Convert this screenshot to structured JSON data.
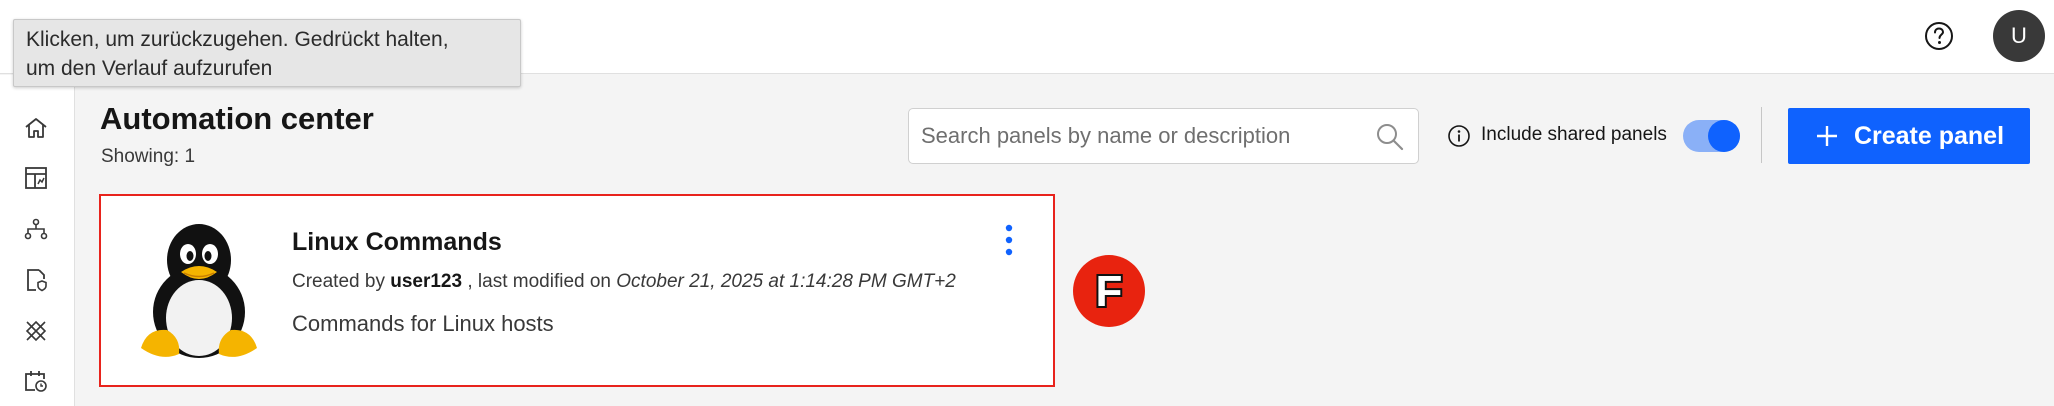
{
  "tooltip": {
    "line1": "Klicken, um zurückzugehen. Gedrückt halten,",
    "line2": "um den Verlauf aufzurufen"
  },
  "header": {
    "help_icon": "question-circle-icon",
    "avatar_initial": "U"
  },
  "sidebar": {
    "items": [
      {
        "icon": "home-icon"
      },
      {
        "icon": "dashboard-icon"
      },
      {
        "icon": "workflow-icon"
      },
      {
        "icon": "document-shield-icon"
      },
      {
        "icon": "automation-icon"
      },
      {
        "icon": "calendar-clock-icon"
      }
    ]
  },
  "main": {
    "title": "Automation center",
    "showing": "Showing: 1",
    "search": {
      "placeholder": "Search panels by name or description",
      "value": ""
    },
    "shared_toggle": {
      "label": "Include shared panels",
      "enabled": true
    },
    "create_button": {
      "label": "Create panel"
    },
    "cards": [
      {
        "title": "Linux Commands",
        "created_by_prefix": "Created by",
        "user": "user123",
        "modified_text": ", last modified on",
        "date": "October 21, 2025 at 1:14:28 PM GMT+2",
        "description": "Commands for Linux hosts",
        "logo": "linux-tux-logo"
      }
    ]
  },
  "badge": {
    "letter": "F"
  },
  "colors": {
    "accent": "#0f62fe",
    "toggle_track": "#8ab0f7",
    "card_highlight": "#e8231c",
    "badge": "#e8230f",
    "avatar": "#393939"
  }
}
